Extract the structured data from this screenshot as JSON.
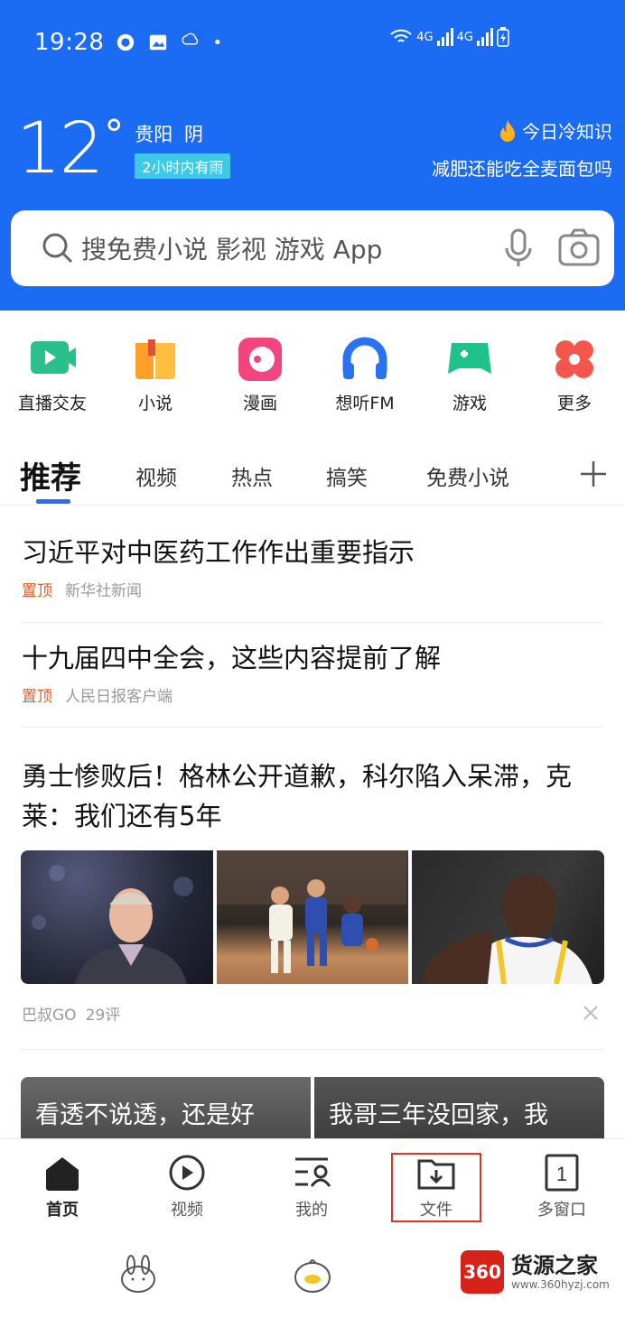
{
  "status": {
    "time": "19:28",
    "signal_1": "4G",
    "signal_2": "4G"
  },
  "weather": {
    "temperature": "12",
    "degree": "°",
    "city": "贵阳",
    "condition": "阴",
    "rain_badge": "2小时内有雨"
  },
  "trivia": {
    "title": "今日冷知识",
    "text": "减肥还能吃全麦面包吗"
  },
  "search": {
    "placeholder": "搜免费小说 影视 游戏 App"
  },
  "apps": [
    {
      "label": "直播交友",
      "icon": "live-video-icon"
    },
    {
      "label": "小说",
      "icon": "book-icon"
    },
    {
      "label": "漫画",
      "icon": "comic-icon"
    },
    {
      "label": "想听FM",
      "icon": "headphone-icon"
    },
    {
      "label": "游戏",
      "icon": "gamepad-icon"
    },
    {
      "label": "更多",
      "icon": "grid-more-icon"
    }
  ],
  "tabs": [
    "推荐",
    "视频",
    "热点",
    "搞笑",
    "免费小说"
  ],
  "news": [
    {
      "title": "习近平对中医药工作作出重要指示",
      "pin": "置顶",
      "source": "新华社新闻"
    },
    {
      "title": "十九届四中全会，这些内容提前了解",
      "pin": "置顶",
      "source": "人民日报客户端"
    },
    {
      "title": "勇士惨败后！格林公开道歉，科尔陷入呆滞，克莱：我们还有5年",
      "source": "巴叔GO",
      "comments": "29评"
    }
  ],
  "cards": [
    "看透不说透，还是好",
    "我哥三年没回家，我"
  ],
  "bottom_nav": [
    {
      "label": "首页",
      "icon": "home-icon"
    },
    {
      "label": "视频",
      "icon": "play-circle-icon"
    },
    {
      "label": "我的",
      "icon": "profile-icon"
    },
    {
      "label": "文件",
      "icon": "folder-download-icon"
    },
    {
      "label": "多窗口",
      "icon": "window-count-icon",
      "count": "1"
    }
  ],
  "watermark": {
    "badge": "360",
    "name": "货源之家",
    "url": "www.360hyzj.com"
  },
  "colors": {
    "header_blue": "#1b6cf2",
    "pin_orange": "#e25a2a",
    "highlight_red": "#e0322a"
  }
}
